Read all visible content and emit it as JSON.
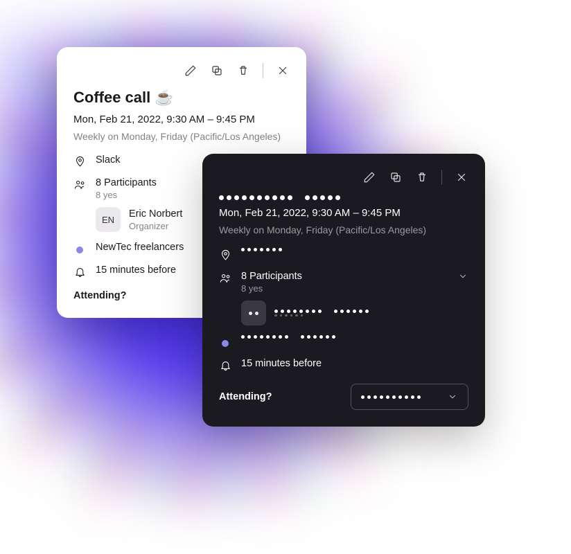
{
  "event": {
    "title": "Coffee call",
    "title_emoji": "☕",
    "datetime": "Mon, Feb 21, 2022, 9:30 AM – 9:45 PM",
    "recurrence": "Weekly on Monday, Friday (Pacific/Los Angeles)",
    "location": "Slack",
    "participants_label": "8 Participants",
    "participants_yes": "8 yes",
    "organizer": {
      "name": "Eric Norbert",
      "role": "Organizer",
      "initials": "EN"
    },
    "tag": "NewTec freelancers",
    "reminder": "15 minutes before",
    "attending_label": "Attending?"
  },
  "dark": {
    "title_dots": [
      10,
      5
    ],
    "location_dots": 7,
    "participants_label": "8 Participants",
    "participants_yes": "8 yes",
    "organizer_name_dots": [
      8,
      6
    ],
    "organizer_role_dots": 6,
    "tag_dots": [
      8,
      6
    ],
    "reminder": "15 minutes before",
    "attending_label": "Attending?",
    "dropdown_dots": 10,
    "avatar_dots": 2
  },
  "colors": {
    "tag_dot": "#8a87e6"
  }
}
